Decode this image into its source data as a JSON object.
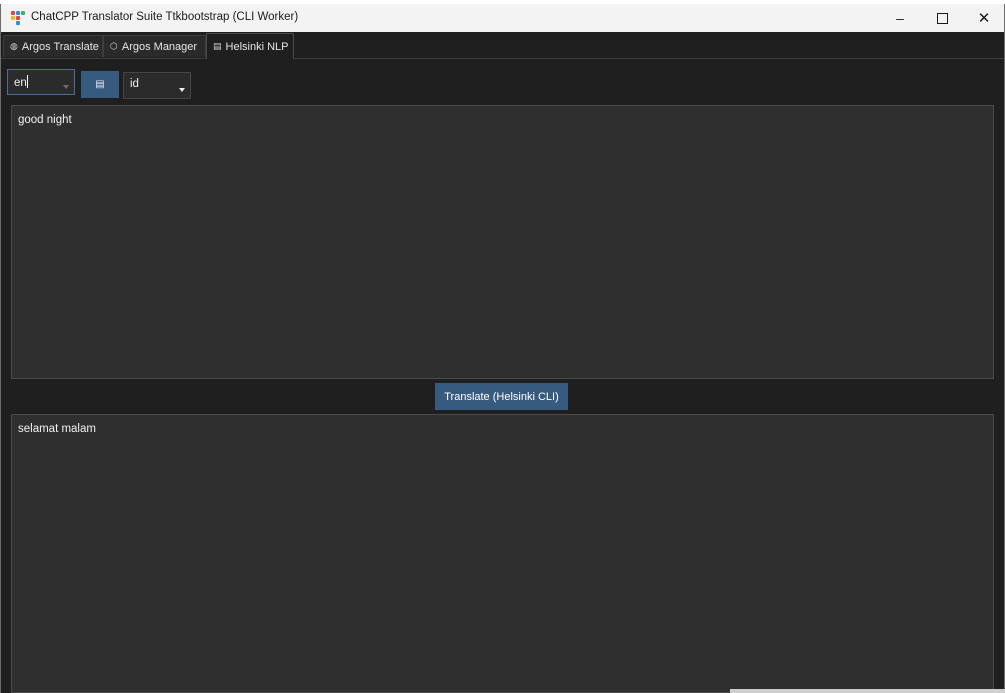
{
  "window": {
    "title": "ChatCPP Translator Suite Ttkbootstrap (CLI Worker)",
    "controls": {
      "minimize_icon": "minimize-icon",
      "maximize_icon": "maximize-icon",
      "close_icon": "close-icon"
    }
  },
  "tabs": [
    {
      "label": "Argos Translate",
      "icon": "globe-icon",
      "active": false
    },
    {
      "label": "Argos Manager",
      "icon": "package-icon",
      "active": false
    },
    {
      "label": "Helsinki NLP",
      "icon": "floppy-icon",
      "active": true
    }
  ],
  "controls": {
    "source_language": "en",
    "swap_icon": "swap-icon",
    "target_language": "id"
  },
  "input": {
    "text": "good night"
  },
  "translate_button": {
    "label": "Translate (Helsinki CLI)"
  },
  "output": {
    "text": "selamat malam"
  },
  "colors": {
    "window_bg": "#1f1f1f",
    "textbox_bg": "#2f2f2f",
    "accent": "#375a7f",
    "titlebar_bg": "#f3f3f3"
  }
}
